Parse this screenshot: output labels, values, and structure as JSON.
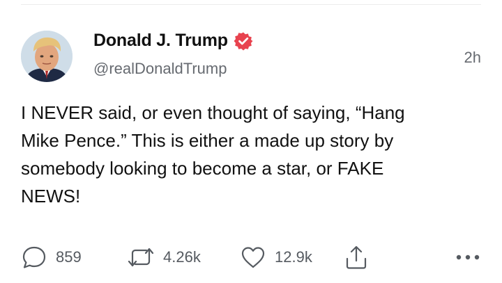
{
  "tweet": {
    "author": {
      "display_name": "Donald J. Trump",
      "handle": "@realDonaldTrump",
      "verified_icon": "verified-badge-icon",
      "avatar": "profile-photo"
    },
    "time": "2h",
    "text": "I NEVER said, or even thought of saying, “Hang\nMike Pence.” This is either a made up story by\nsomebody looking to become a star, or FAKE\nNEWS!",
    "actions": {
      "reply": {
        "icon": "reply-icon",
        "count": "859"
      },
      "retweet": {
        "icon": "retweet-icon",
        "count": "4.26k"
      },
      "like": {
        "icon": "heart-icon",
        "count": "12.9k"
      },
      "share": {
        "icon": "share-icon"
      },
      "more": {
        "icon": "more-icon"
      }
    }
  },
  "colors": {
    "text": "#111111",
    "secondary": "#666a70",
    "verified": "#e8434f",
    "icon": "#555a60"
  }
}
